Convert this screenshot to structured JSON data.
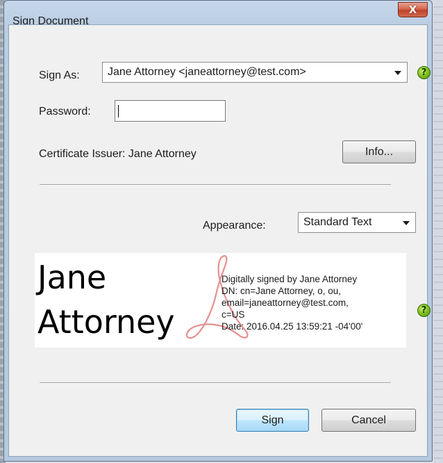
{
  "window": {
    "title": "Sign Document",
    "close_glyph": "X"
  },
  "sign_as": {
    "label": "Sign As:",
    "value": "Jane Attorney <janeattorney@test.com>"
  },
  "password": {
    "label": "Password:",
    "value": ""
  },
  "certificate": {
    "issuer_text": "Certificate Issuer: Jane Attorney",
    "info_button": "Info..."
  },
  "appearance": {
    "label": "Appearance:",
    "value": "Standard Text"
  },
  "signature_preview": {
    "name_line1": "Jane",
    "name_line2": "Attorney",
    "details": [
      "Digitally signed by Jane Attorney",
      "DN: cn=Jane Attorney, o, ou,",
      "email=janeattorney@test.com,",
      "c=US",
      "Date: 2016.04.25 13:59:21 -04'00'"
    ]
  },
  "buttons": {
    "sign": "Sign",
    "cancel": "Cancel"
  },
  "help_glyph": "?",
  "icons": {
    "help": "help-icon",
    "close": "close-icon",
    "dropdown": "chevron-down-icon",
    "watermark": "acrobat-logo-icon"
  },
  "colors": {
    "help_icon": "#86c521",
    "close_button": "#c2412a",
    "default_button_border": "#3c7fb1",
    "watermark": "#e58f8f"
  }
}
